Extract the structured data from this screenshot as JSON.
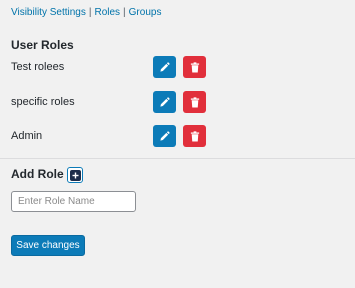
{
  "nav": {
    "items": [
      {
        "label": "Visibility Settings"
      },
      {
        "label": "Roles"
      },
      {
        "label": "Groups"
      }
    ],
    "separator": "|"
  },
  "user_roles": {
    "title": "User Roles",
    "roles": [
      {
        "name": "Test rolees"
      },
      {
        "name": "specific roles"
      },
      {
        "name": "Admin"
      }
    ],
    "edit_icon": "pencil-icon",
    "delete_icon": "trash-icon"
  },
  "add_role": {
    "title": "Add Role",
    "add_icon": "plus-icon",
    "input_placeholder": "Enter Role Name",
    "input_value": ""
  },
  "save_label": "Save changes",
  "colors": {
    "link": "#0073aa",
    "primary": "#0c7bb8",
    "danger": "#e12f3b",
    "background": "#f1f1f1"
  }
}
